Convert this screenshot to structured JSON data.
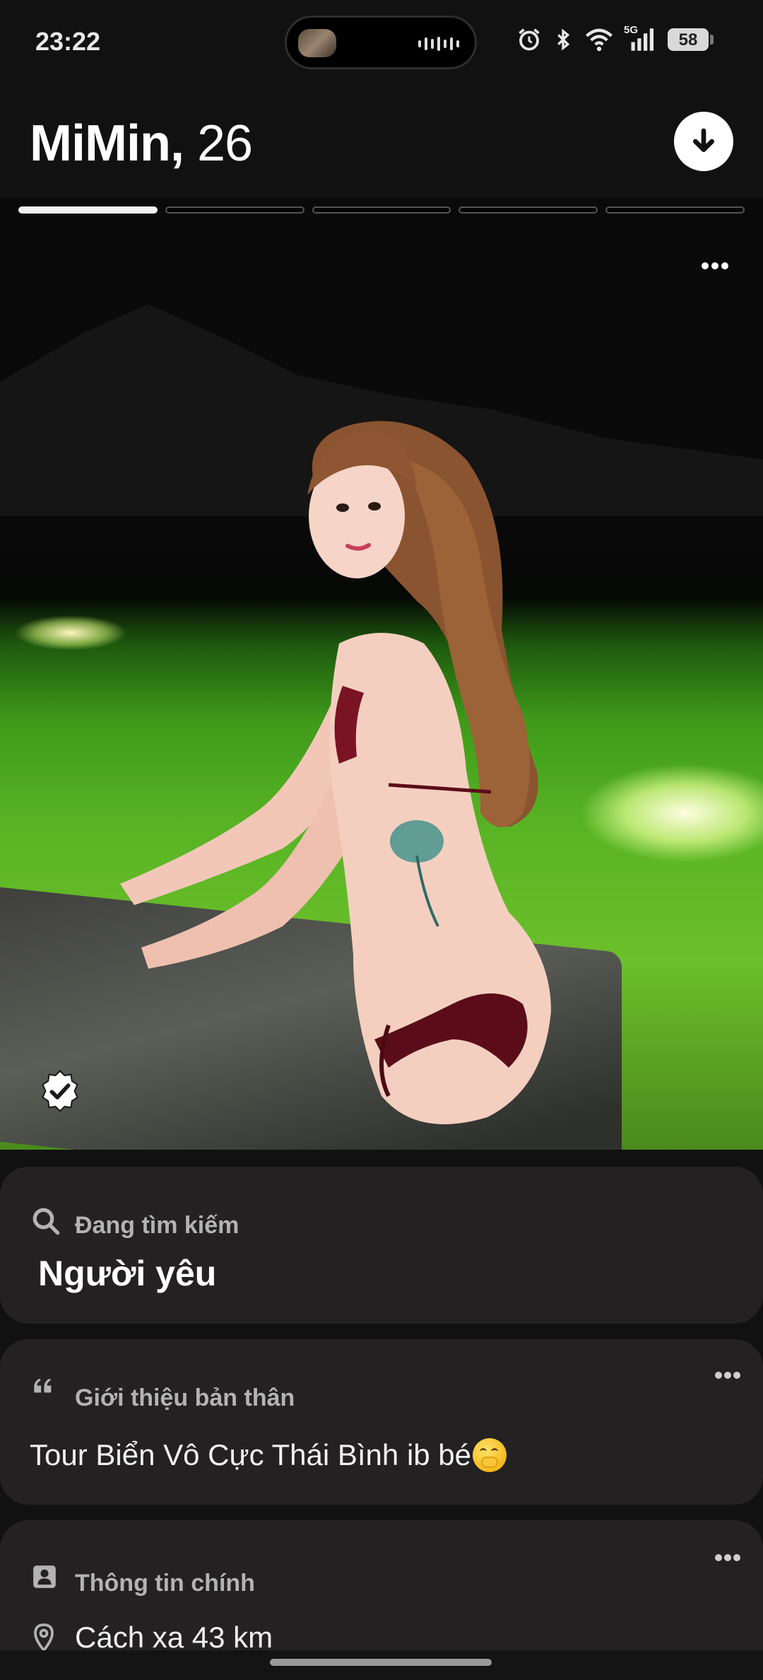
{
  "status_bar": {
    "time": "23:22",
    "network": "5G",
    "battery": "58",
    "battery_fraction": 0.58,
    "icons": [
      "alarm-icon",
      "bluetooth-icon",
      "wifi-icon",
      "signal-icon",
      "battery-icon"
    ]
  },
  "profile": {
    "name": "MiMin,",
    "age": "26",
    "photo_count": 5,
    "active_photo_index": 0
  },
  "looking_for": {
    "title": "Đang tìm kiếm",
    "value": "Người yêu",
    "icon": "search-icon"
  },
  "about": {
    "title": "Giới thiệu bản thân",
    "text": "Tour Biển Vô Cực Thái Bình ib bé",
    "emoji": "face-with-hand-over-mouth",
    "icon": "quote-icon"
  },
  "main_info": {
    "title": "Thông tin chính",
    "distance": "Cách xa 43 km",
    "icon": "id-card-icon",
    "distance_icon": "location-pin-icon"
  },
  "colors": {
    "background": "#111111",
    "card": "#232121",
    "card_title": "#b3b3b3",
    "progress_active": "#f2f2f2"
  }
}
